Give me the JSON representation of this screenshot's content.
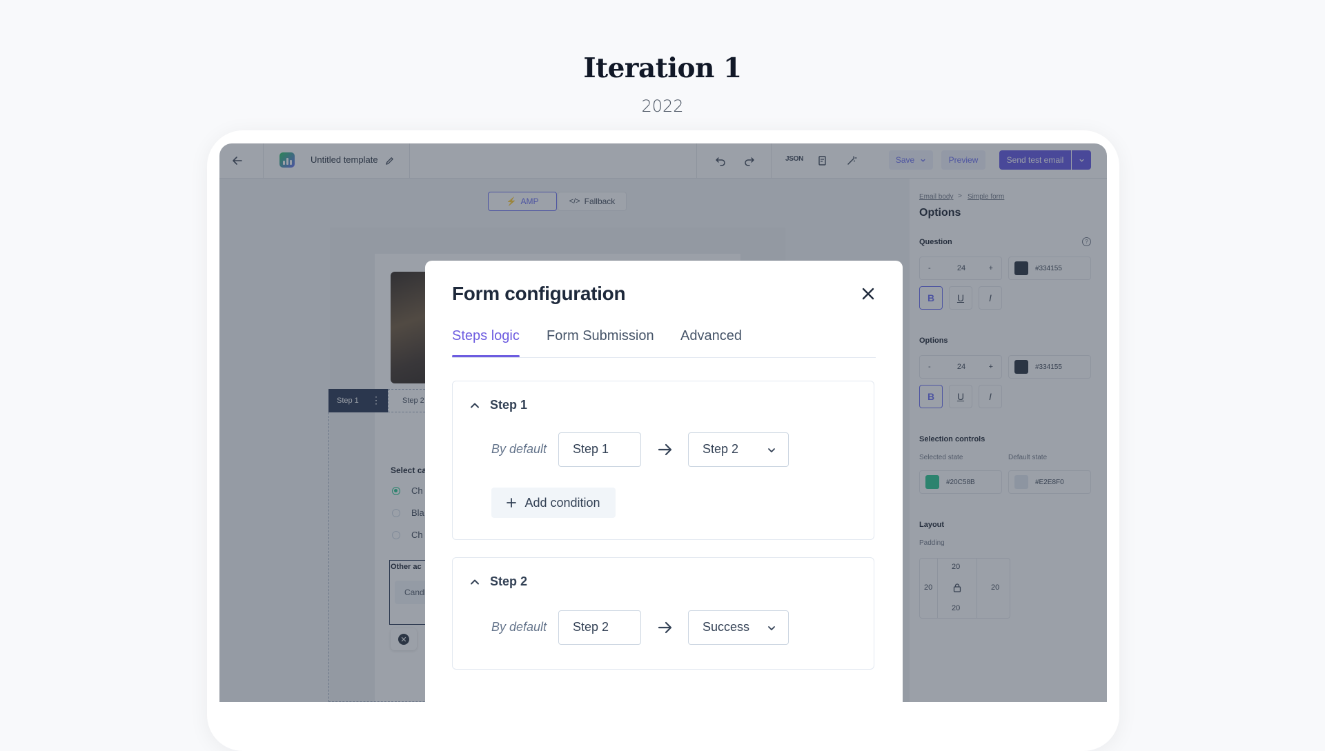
{
  "headline": "Iteration 1",
  "year": "2022",
  "editor": {
    "template_title": "Untitled template",
    "json_label": "JSON",
    "save_label": "Save",
    "preview_label": "Preview",
    "send_label": "Send test email",
    "amp_label": "AMP",
    "fallback_label": "Fallback",
    "step_tabs": [
      "Step 1",
      "Step 2"
    ],
    "question": "Select ca",
    "options": [
      "Ch",
      "Bla",
      "Ch"
    ],
    "other_label": "Other ac",
    "other_input": "Candl"
  },
  "panel": {
    "breadcrumb": [
      "Email body",
      "Simple form"
    ],
    "crumb_sep": ">",
    "title": "Options",
    "question_section": "Question",
    "options_section": "Options",
    "font_size": "24",
    "minus": "-",
    "plus": "+",
    "text_color": "#334155",
    "selection_section": "Selection controls",
    "selected_state": "Selected state",
    "default_state": "Default state",
    "selected_color": "#20C58B",
    "default_color": "#E2E8F0",
    "layout_section": "Layout",
    "padding_label": "Padding",
    "padding": {
      "top": "20",
      "left": "20",
      "right": "20",
      "bottom": "20"
    }
  },
  "modal": {
    "title": "Form configuration",
    "tabs": [
      "Steps logic",
      "Form Submission",
      "Advanced"
    ],
    "active_tab": "Steps logic",
    "by_default": "By default",
    "add_condition": "Add condition",
    "steps": [
      {
        "name": "Step 1",
        "from": "Step 1",
        "to": "Step 2"
      },
      {
        "name": "Step 2",
        "from": "Step 2",
        "to": "Success"
      }
    ]
  },
  "colors": {
    "accent": "#6D5CE0",
    "primary_button": "#5B4FE0",
    "selected_state": "#20C58B",
    "default_state": "#E2E8F0",
    "text_color": "#334155"
  }
}
